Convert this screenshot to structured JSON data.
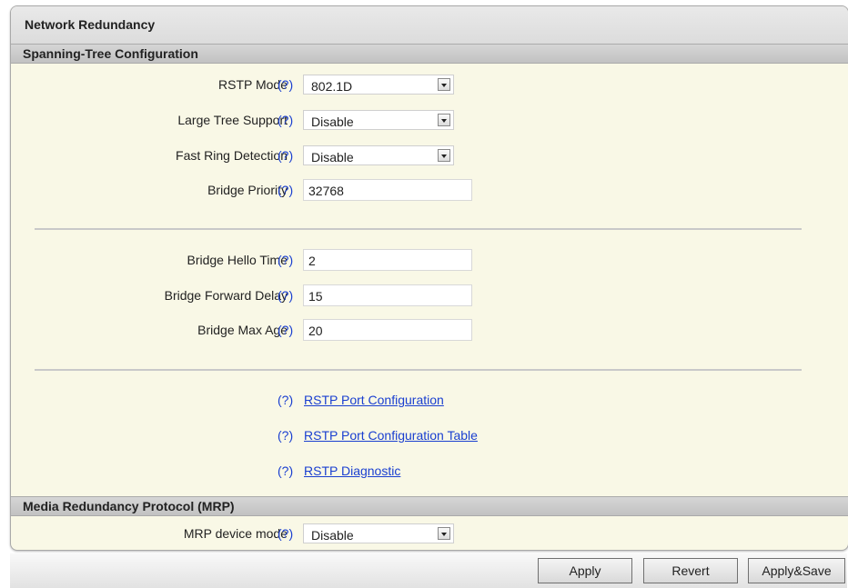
{
  "panel": {
    "title": "Network Redundancy"
  },
  "spanning_tree": {
    "section_title": "Spanning-Tree Configuration",
    "help": "(?)",
    "rstp_mode": {
      "label": "RSTP Mode",
      "value": "802.1D"
    },
    "large_tree_support": {
      "label": "Large Tree Support",
      "value": "Disable"
    },
    "fast_ring_detection": {
      "label": "Fast Ring Detection",
      "value": "Disable"
    },
    "bridge_priority": {
      "label": "Bridge Priority",
      "value": "32768"
    },
    "bridge_hello_time": {
      "label": "Bridge Hello Time",
      "value": "2"
    },
    "bridge_forward_delay": {
      "label": "Bridge Forward Delay",
      "value": "15"
    },
    "bridge_max_age": {
      "label": "Bridge Max Age",
      "value": "20"
    },
    "links": [
      {
        "label": "RSTP Port Configuration"
      },
      {
        "label": "RSTP Port Configuration Table"
      },
      {
        "label": "RSTP Diagnostic"
      }
    ]
  },
  "mrp": {
    "section_title": "Media Redundancy Protocol (MRP)",
    "device_mode": {
      "label": "MRP device mode",
      "value": "Disable"
    }
  },
  "buttons": {
    "apply": "Apply",
    "revert": "Revert",
    "apply_save": "Apply&Save"
  },
  "colors": {
    "panel_background": "#f9f8e6",
    "link": "#1a3fd0",
    "section_header": "#cfcfcf"
  }
}
